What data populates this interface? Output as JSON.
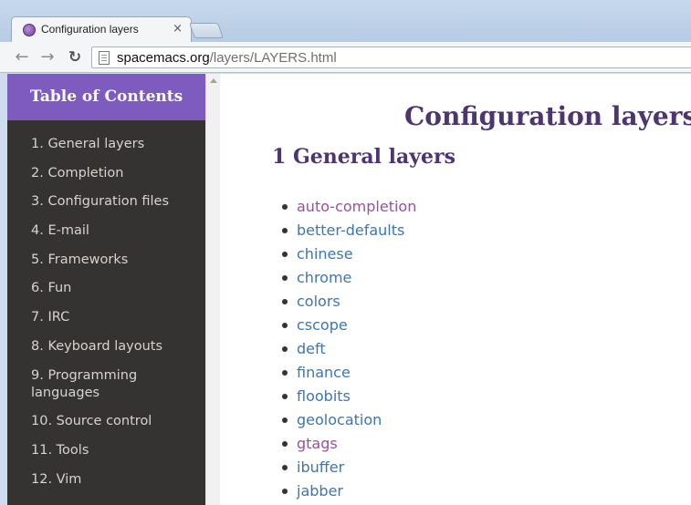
{
  "browser": {
    "tab_title": "Configuration layers",
    "tab_close": "×",
    "url_host": "spacemacs.org",
    "url_path": "/layers/LAYERS.html"
  },
  "sidebar": {
    "title": "Table of Contents",
    "items": [
      "1. General layers",
      "2. Completion",
      "3. Configuration files",
      "4. E-mail",
      "5. Frameworks",
      "6. Fun",
      "7. IRC",
      "8. Keyboard layouts",
      "9. Programming languages",
      "10. Source control",
      "11. Tools",
      "12. Vim"
    ]
  },
  "main": {
    "title": "Configuration layers",
    "section_title": "1 General layers",
    "layers": [
      {
        "label": "auto-completion",
        "visited": true
      },
      {
        "label": "better-defaults",
        "visited": false
      },
      {
        "label": "chinese",
        "visited": false
      },
      {
        "label": "chrome",
        "visited": false
      },
      {
        "label": "colors",
        "visited": false
      },
      {
        "label": "cscope",
        "visited": false
      },
      {
        "label": "deft",
        "visited": false
      },
      {
        "label": "finance",
        "visited": false
      },
      {
        "label": "floobits",
        "visited": false
      },
      {
        "label": "geolocation",
        "visited": false
      },
      {
        "label": "gtags",
        "visited": true
      },
      {
        "label": "ibuffer",
        "visited": false
      },
      {
        "label": "jabber",
        "visited": false
      }
    ]
  },
  "colors": {
    "toc_header_bg": "#7e5bbf",
    "sidebar_bg": "#353331",
    "heading": "#4c3571",
    "link": "#3b76b2",
    "link_visited": "#9a4f9f"
  }
}
